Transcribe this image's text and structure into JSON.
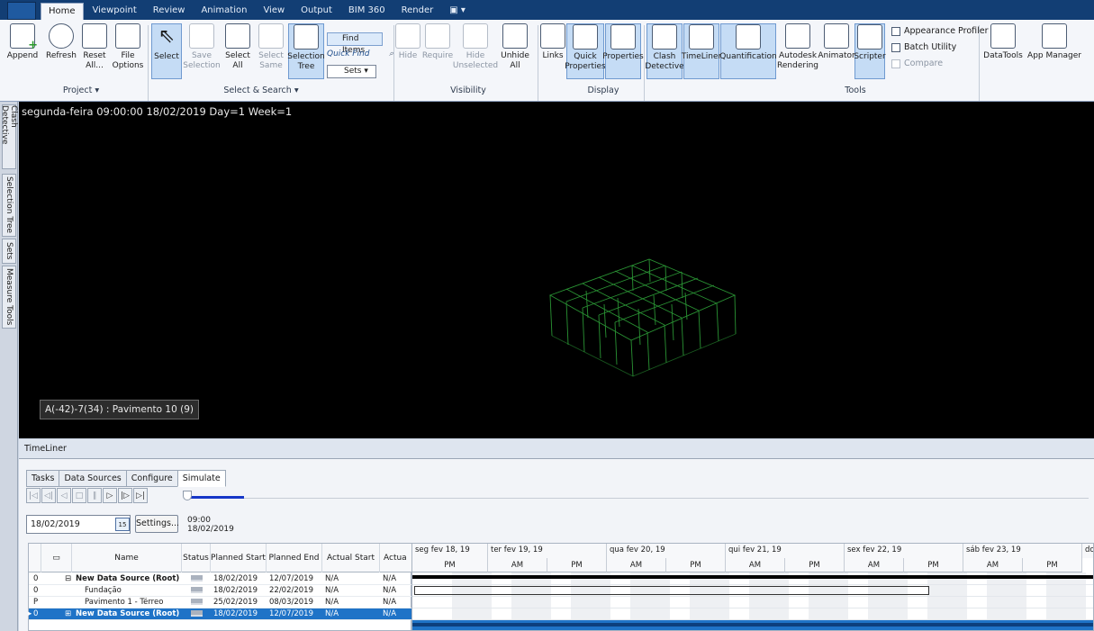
{
  "ribbon": {
    "tabs": [
      "Home",
      "Viewpoint",
      "Review",
      "Animation",
      "View",
      "Output",
      "BIM 360",
      "Render"
    ],
    "active_tab": "Home",
    "project": {
      "label": "Project",
      "append": "Append",
      "refresh": "Refresh",
      "reset_all": "Reset All...",
      "file_options": "File Options"
    },
    "select_search": {
      "label": "Select & Search",
      "select": "Select",
      "save_selection": "Save Selection",
      "select_all": "Select All",
      "select_same": "Select Same",
      "selection_tree": "Selection Tree",
      "find_items": "Find Items",
      "quick_find": "Quick Find",
      "sets": "Sets"
    },
    "visibility": {
      "label": "Visibility",
      "hide": "Hide",
      "require": "Require",
      "hide_unselected": "Hide Unselected",
      "unhide_all": "Unhide All"
    },
    "display": {
      "label": "Display",
      "links": "Links",
      "quick_properties": "Quick Properties",
      "properties": "Properties"
    },
    "tools": {
      "label": "Tools",
      "clash_detective": "Clash Detective",
      "timeliner": "TimeLiner",
      "quantification": "Quantification",
      "autodesk_rendering": "Autodesk Rendering",
      "animator": "Animator",
      "scripter": "Scripter",
      "appearance_profiler": "Appearance Profiler",
      "batch_utility": "Batch Utility",
      "compare": "Compare",
      "datatools": "DataTools",
      "app_manager": "App Manager"
    }
  },
  "left_dock": {
    "tabs": [
      "Clash Detective",
      "Selection Tree",
      "Sets",
      "Measure Tools"
    ]
  },
  "viewport": {
    "overlay_date": "segunda-feira 09:00:00 18/02/2019 Day=1 Week=1",
    "tooltip": "A(-42)-7(34) : Pavimento 10 (9)",
    "model_color": "#2fa33a"
  },
  "timeliner": {
    "title": "TimeLiner",
    "tabs": [
      "Tasks",
      "Data Sources",
      "Configure",
      "Simulate"
    ],
    "active_tab": "Simulate",
    "date_value": "18/02/2019",
    "calendar_icon_text": "15",
    "settings_label": "Settings...",
    "current_time": "09:00",
    "current_date": "18/02/2019",
    "progress": 0.06,
    "columns": [
      "Name",
      "Status",
      "Planned Start",
      "Planned End",
      "Actual Start",
      "Actua"
    ],
    "rows": [
      {
        "id": "0",
        "name": "New Data Source (Root)",
        "planned_start": "18/02/2019",
        "planned_end": "12/07/2019",
        "actual_start": "N/A",
        "actual_end": "N/A",
        "bold": true,
        "expand": "⊟"
      },
      {
        "id": "0",
        "name": "Fundação",
        "planned_start": "18/02/2019",
        "planned_end": "22/02/2019",
        "actual_start": "N/A",
        "actual_end": "N/A",
        "bold": false,
        "expand": ""
      },
      {
        "id": "P",
        "name": "Pavimento 1 - Térreo",
        "planned_start": "25/02/2019",
        "planned_end": "08/03/2019",
        "actual_start": "N/A",
        "actual_end": "N/A",
        "bold": false,
        "expand": ""
      },
      {
        "id": "0",
        "name": "New Data Source (Root)",
        "planned_start": "18/02/2019",
        "planned_end": "12/07/2019",
        "actual_start": "N/A",
        "actual_end": "N/A",
        "bold": true,
        "expand": "⊞"
      }
    ],
    "gantt": {
      "days": [
        "seg fev 18, 19",
        "ter fev 19, 19",
        "qua fev 20, 19",
        "qui fev 21, 19",
        "sex fev 22, 19",
        "sáb fev 23, 19",
        "dom"
      ],
      "halves": [
        "PM",
        "AM",
        "PM",
        "AM",
        "PM",
        "AM",
        "PM",
        "AM",
        "PM",
        "AM",
        "PM"
      ],
      "bar_color": "#000000",
      "selected_color": "#1f73c7"
    }
  }
}
